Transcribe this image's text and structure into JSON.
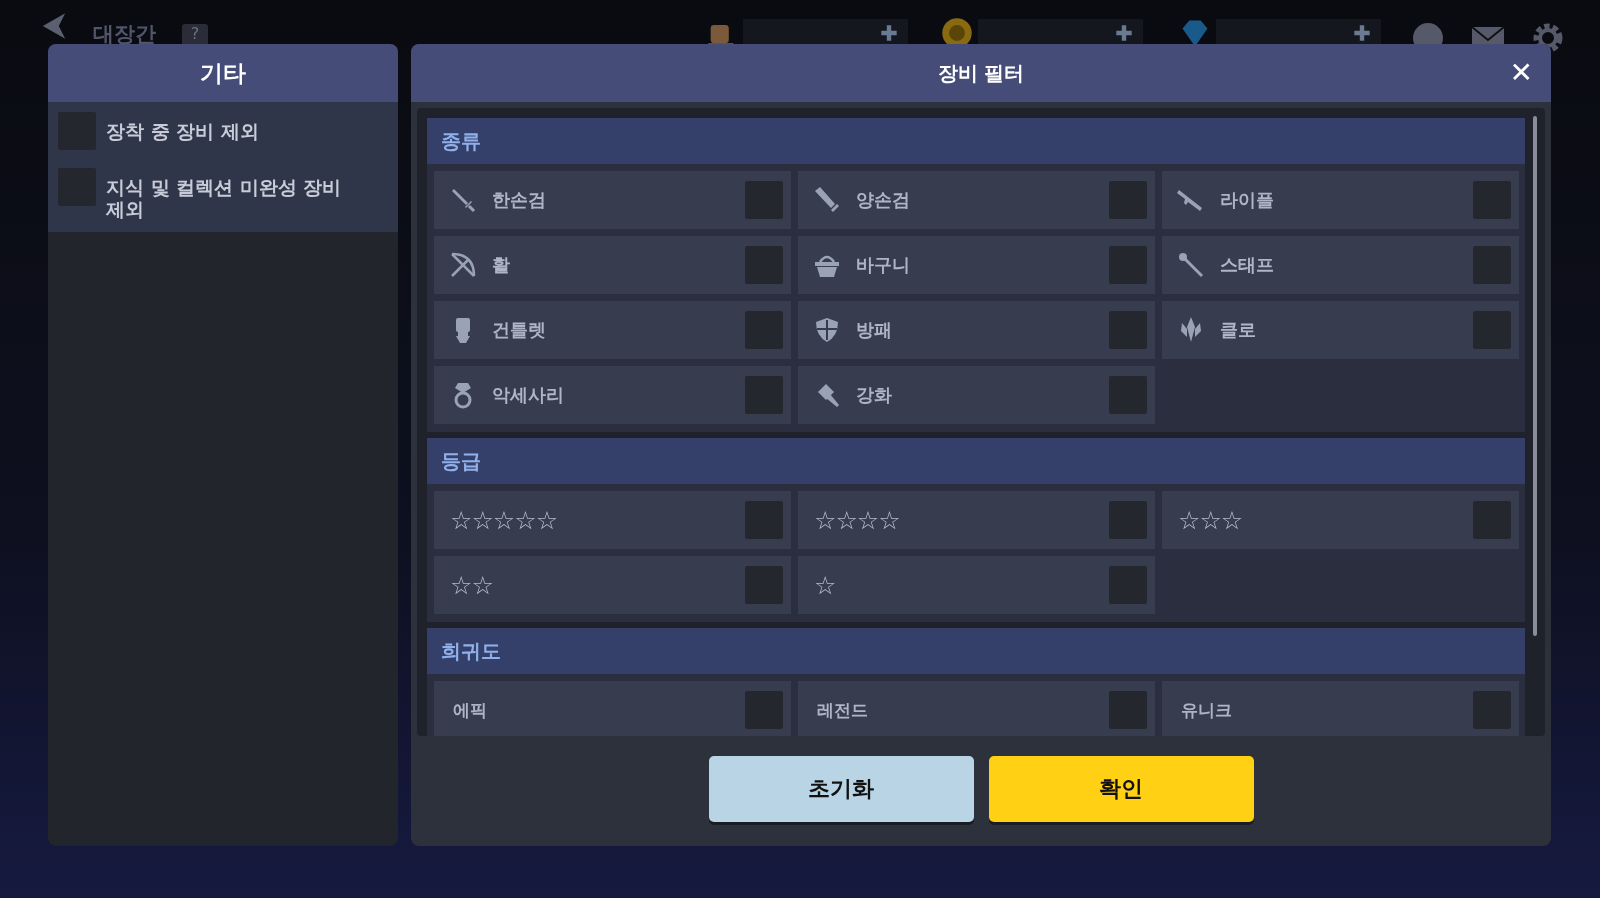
{
  "top_bar": {
    "title": "대장간",
    "help": "?"
  },
  "side_panel": {
    "title": "기타",
    "options": [
      {
        "label": "장착 중 장비 제외",
        "checked": false
      },
      {
        "label": "지식 및 컬렉션 미완성 장비 제외",
        "checked": false
      }
    ]
  },
  "filter_dialog": {
    "title": "장비 필터",
    "close": "✕",
    "type_section": {
      "title": "종류",
      "items": [
        {
          "label": "한손검",
          "checked": false
        },
        {
          "label": "양손검",
          "checked": false
        },
        {
          "label": "라이플",
          "checked": false
        },
        {
          "label": "활",
          "checked": false
        },
        {
          "label": "바구니",
          "checked": false
        },
        {
          "label": "스태프",
          "checked": false
        },
        {
          "label": "건틀렛",
          "checked": false
        },
        {
          "label": "방패",
          "checked": false
        },
        {
          "label": "클로",
          "checked": false
        },
        {
          "label": "악세사리",
          "checked": false
        },
        {
          "label": "강화",
          "checked": false
        }
      ]
    },
    "grade_section": {
      "title": "등급",
      "items": [
        {
          "label": "☆☆☆☆☆",
          "checked": false
        },
        {
          "label": "☆☆☆☆",
          "checked": false
        },
        {
          "label": "☆☆☆",
          "checked": false
        },
        {
          "label": "☆☆",
          "checked": false
        },
        {
          "label": "☆",
          "checked": false
        }
      ]
    },
    "rarity_section": {
      "title": "희귀도",
      "items": [
        {
          "label": "에픽",
          "checked": false
        },
        {
          "label": "레전드",
          "checked": false
        },
        {
          "label": "유니크",
          "checked": false
        }
      ]
    },
    "buttons": [
      {
        "label": "초기화",
        "kind": "secondary"
      },
      {
        "label": "확인",
        "kind": "primary"
      }
    ]
  }
}
